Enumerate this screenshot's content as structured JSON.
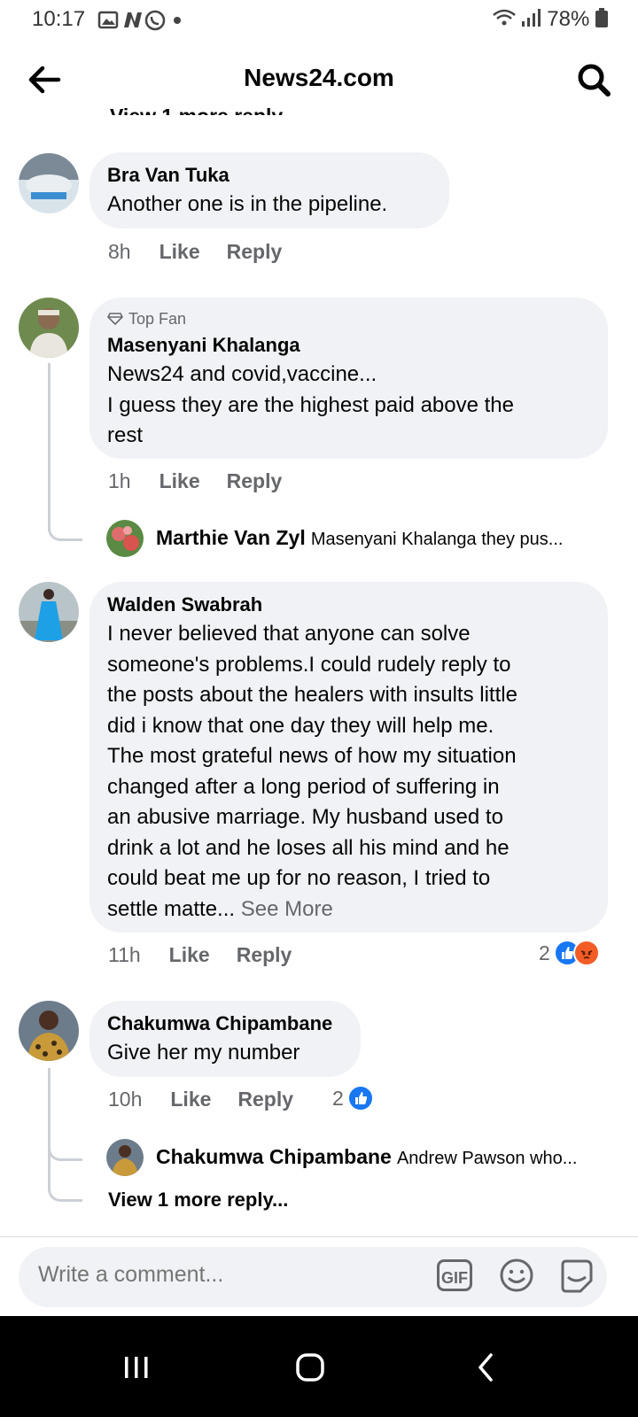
{
  "status_bar": {
    "time": "10:17",
    "battery": "78%"
  },
  "app_bar": {
    "title": "News24.com"
  },
  "hidden_top_reply": "View 1 more reply...",
  "comments": [
    {
      "name": "Bra Van Tuka",
      "text": "Another one is in the pipeline.",
      "time": "8h",
      "like": "Like",
      "reply": "Reply"
    },
    {
      "badge": "Top Fan",
      "name": "Masenyani Khalanga",
      "text_lines": [
        "News24 and covid,vaccine...",
        "I guess they are the highest paid above the",
        "rest"
      ],
      "time": "1h",
      "like": "Like",
      "reply": "Reply",
      "reply_preview": {
        "name": "Marthie Van Zyl",
        "text": "Masenyani Khalanga they pus..."
      }
    },
    {
      "name": "Walden Swabrah",
      "text_lines": [
        "I never believed that anyone can solve",
        "someone's problems.I could rudely reply to",
        "the posts about the healers with insults little",
        "did i know that one day they will help me.",
        "The most grateful news of how my situation",
        "changed after a long period of suffering in",
        "an abusive marriage. My husband used to",
        "drink a lot and he loses all his mind and he",
        "could beat me up for no reason, I tried to"
      ],
      "last_line": "settle matte... ",
      "see_more": "See More",
      "time": "11h",
      "like": "Like",
      "reply": "Reply",
      "reaction_count": "2",
      "reactions": [
        "like",
        "angry"
      ]
    },
    {
      "name": "Chakumwa Chipambane",
      "text": "Give her my number",
      "time": "10h",
      "like": "Like",
      "reply": "Reply",
      "reaction_count": "2",
      "reactions": [
        "like"
      ],
      "reply_preview": {
        "name": "Chakumwa Chipambane",
        "text": "Andrew Pawson who..."
      },
      "view_more": "View 1 more reply..."
    }
  ],
  "composer": {
    "placeholder": "Write a comment...",
    "gif_label": "GIF"
  },
  "colors": {
    "bubble": "#f0f2f5",
    "secondary_text": "#65676b",
    "like_blue": "#1877f2",
    "angry_orange": "#f25c27"
  }
}
